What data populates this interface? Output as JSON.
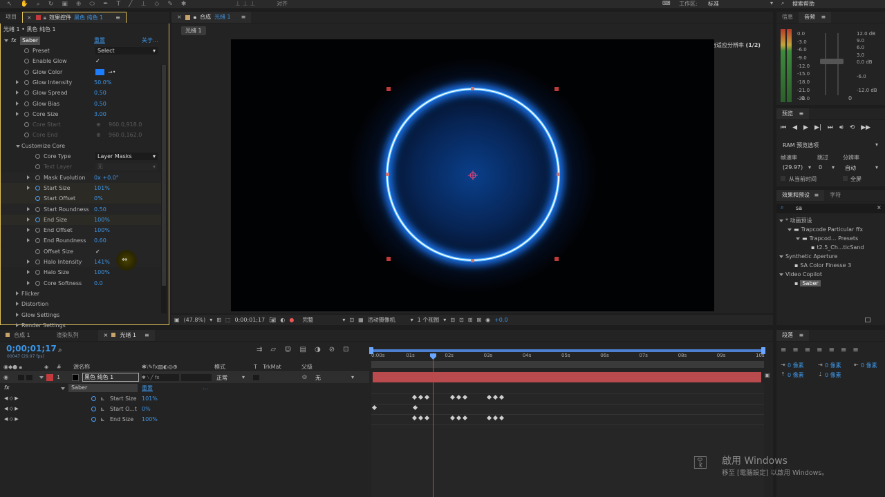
{
  "app_menu": {
    "right_items": [
      "工作区:",
      "标准",
      "搜索帮助"
    ],
    "snap_label": "对齐"
  },
  "left_tabs": {
    "project": "项目",
    "effect_controls": "效果控件",
    "layer_name": "黑色 纯色 1"
  },
  "breadcrumb": "光绪 1 • 黑色 纯色 1",
  "effect": {
    "fx": "fx",
    "name": "Saber",
    "reset": "重置",
    "about": "关于..."
  },
  "params": [
    {
      "name": "Preset",
      "value": "Select",
      "type": "dropdown",
      "indent": 0,
      "twirl": false
    },
    {
      "name": "Enable Glow",
      "value": "✓",
      "type": "check",
      "indent": 0,
      "twirl": false
    },
    {
      "name": "Glow Color",
      "value": "",
      "type": "color",
      "indent": 0,
      "twirl": false
    },
    {
      "name": "Glow Intensity",
      "value": "50.0%",
      "type": "num",
      "indent": 0,
      "twirl": true
    },
    {
      "name": "Glow Spread",
      "value": "0.50",
      "type": "num",
      "indent": 0,
      "twirl": true
    },
    {
      "name": "Glow Bias",
      "value": "0.50",
      "type": "num",
      "indent": 0,
      "twirl": true
    },
    {
      "name": "Core Size",
      "value": "3.00",
      "type": "num",
      "indent": 0,
      "twirl": true
    },
    {
      "name": "Core Start",
      "value": "960.0,918.0",
      "type": "point",
      "indent": 0,
      "twirl": false,
      "disabled": true
    },
    {
      "name": "Core End",
      "value": "960.0,162.0",
      "type": "point",
      "indent": 0,
      "twirl": false,
      "disabled": true
    },
    {
      "name": "Customize Core",
      "value": "",
      "type": "group",
      "indent": -1,
      "twirl": true
    },
    {
      "name": "Core Type",
      "value": "Layer Masks",
      "type": "dropdown",
      "indent": 1,
      "twirl": false
    },
    {
      "name": "Text Layer",
      "value": "无",
      "type": "dropdown",
      "indent": 1,
      "twirl": false,
      "disabled": true
    },
    {
      "name": "Mask Evolution",
      "value": "0x +0.0°",
      "type": "num",
      "indent": 1,
      "twirl": true
    },
    {
      "name": "Start Size",
      "value": "101%",
      "type": "num",
      "indent": 1,
      "twirl": true,
      "kf": true
    },
    {
      "name": "Start Offset",
      "value": "0%",
      "type": "num",
      "indent": 1,
      "twirl": false,
      "kf": true
    },
    {
      "name": "Start Roundness",
      "value": "0.50",
      "type": "num",
      "indent": 1,
      "twirl": true
    },
    {
      "name": "End Size",
      "value": "100%",
      "type": "num",
      "indent": 1,
      "twirl": true,
      "kf": true
    },
    {
      "name": "End Offset",
      "value": "100%",
      "type": "num",
      "indent": 1,
      "twirl": true
    },
    {
      "name": "End Roundness",
      "value": "0.60",
      "type": "num",
      "indent": 1,
      "twirl": true
    },
    {
      "name": "Offset Size",
      "value": "✓",
      "type": "check",
      "indent": 1,
      "twirl": false
    },
    {
      "name": "Halo Intensity",
      "value": "141%",
      "type": "num",
      "indent": 1,
      "twirl": true
    },
    {
      "name": "Halo Size",
      "value": "100%",
      "type": "num",
      "indent": 1,
      "twirl": true
    },
    {
      "name": "Core Softness",
      "value": "0.0",
      "type": "num",
      "indent": 1,
      "twirl": true
    }
  ],
  "groups": [
    "Flicker",
    "Distortion",
    "Glow Settings",
    "Render Settings"
  ],
  "comp": {
    "tab_label": "合成",
    "comp_name": "光绪 1",
    "sub_tab": "光绪 1",
    "resolution_note": "自适应分辨率",
    "resolution_frac": "(1/2)",
    "zoom": "(47.8%)",
    "timecode": "0;00;01;17",
    "quality": "完整",
    "camera": "活动摄像机",
    "views": "1 个视图",
    "offset": "+0.0"
  },
  "right": {
    "info_tab": "信息",
    "audio_tab": "音频",
    "meter_left": [
      "0.0",
      "-3.0",
      "-6.0",
      "-9.0",
      "-12.0",
      "-15.0",
      "-18.0",
      "-21.0",
      "-24.0"
    ],
    "meter_right": [
      "12.0 dB",
      "9.0",
      "6.0",
      "3.0",
      "0.0 dB",
      "-6.0",
      "-12.0 dB"
    ],
    "meter_bottom": [
      "0",
      "0"
    ],
    "preview_tab": "预览",
    "ram_label": "RAM 预览选项",
    "frame_rate_label": "帧速率",
    "skip_label": "跳过",
    "resolution_label": "分辨率",
    "frame_rate": "(29.97)",
    "skip": "0",
    "resolution": "自动",
    "from_current": "从当前时间",
    "fullscreen": "全屏",
    "fx_tab": "效果和预设",
    "char_tab": "字符",
    "search": "sa",
    "tree": [
      {
        "label": "* 动画预设",
        "level": 0,
        "folder": false
      },
      {
        "label": "Trapcode Particular ffx",
        "level": 1,
        "folder": true
      },
      {
        "label": "Trapcod... Presets",
        "level": 2,
        "folder": true
      },
      {
        "label": "t2.5_Ch...ticSand",
        "level": 3,
        "folder": false,
        "file": true
      },
      {
        "label": "Synthetic Aperture",
        "level": 0,
        "folder": false
      },
      {
        "label": "SA Color Finesse 3",
        "level": 1,
        "folder": false,
        "file": true
      },
      {
        "label": "Video Copilot",
        "level": 0,
        "folder": false
      },
      {
        "label": "Saber",
        "level": 1,
        "folder": false,
        "file": true,
        "selected": true
      }
    ],
    "para_tab": "段落",
    "para_vals": [
      "0 像素",
      "0 像素",
      "0 像素",
      "0 像素",
      "0 像素"
    ]
  },
  "timeline": {
    "tabs": [
      "合成 1",
      "渲染队列",
      "光绪 1"
    ],
    "timecode": "0;00;01;17",
    "frames": "00047 (29.97 fps)",
    "search_placeholder": "",
    "col_source": "源名称",
    "col_mode": "模式",
    "col_t": "T",
    "col_trkmat": "TrkMat",
    "col_parent": "父级",
    "layer_num": "1",
    "layer_name": "黑色 纯色 1",
    "layer_mode": "正常",
    "layer_parent": "无",
    "fx_label": "fx",
    "saber": "Saber",
    "saber_reset": "重置",
    "props": [
      {
        "name": "Start Size",
        "value": "101%"
      },
      {
        "name": "Start O...t",
        "value": "0%"
      },
      {
        "name": "End Size",
        "value": "100%"
      }
    ],
    "ruler": [
      "0:00s",
      "01s",
      "02s",
      "03s",
      "04s",
      "05s",
      "06s",
      "07s",
      "08s",
      "09s",
      "10s"
    ]
  },
  "watermark": {
    "title": "啟用 Windows",
    "sub": "移至 [電腦設定] 以啟用 Windows。"
  }
}
